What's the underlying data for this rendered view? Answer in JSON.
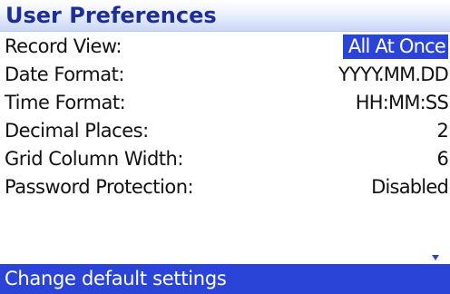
{
  "header": {
    "title": "User Preferences"
  },
  "settings": [
    {
      "label": "Record View:",
      "value": "All At Once",
      "selected": true
    },
    {
      "label": "Date Format:",
      "value": "YYYY.MM.DD",
      "selected": false
    },
    {
      "label": "Time Format:",
      "value": "HH:MM:SS",
      "selected": false
    },
    {
      "label": "Decimal Places:",
      "value": "2",
      "selected": false
    },
    {
      "label": "Grid Column Width:",
      "value": "6",
      "selected": false
    },
    {
      "label": "Password Protection:",
      "value": "Disabled",
      "selected": false
    }
  ],
  "scroll": {
    "icon": "chevron-down-icon"
  },
  "status": {
    "text": "Change default settings"
  },
  "colors": {
    "accent": "#2a44d8",
    "title": "#1d2d9a"
  }
}
